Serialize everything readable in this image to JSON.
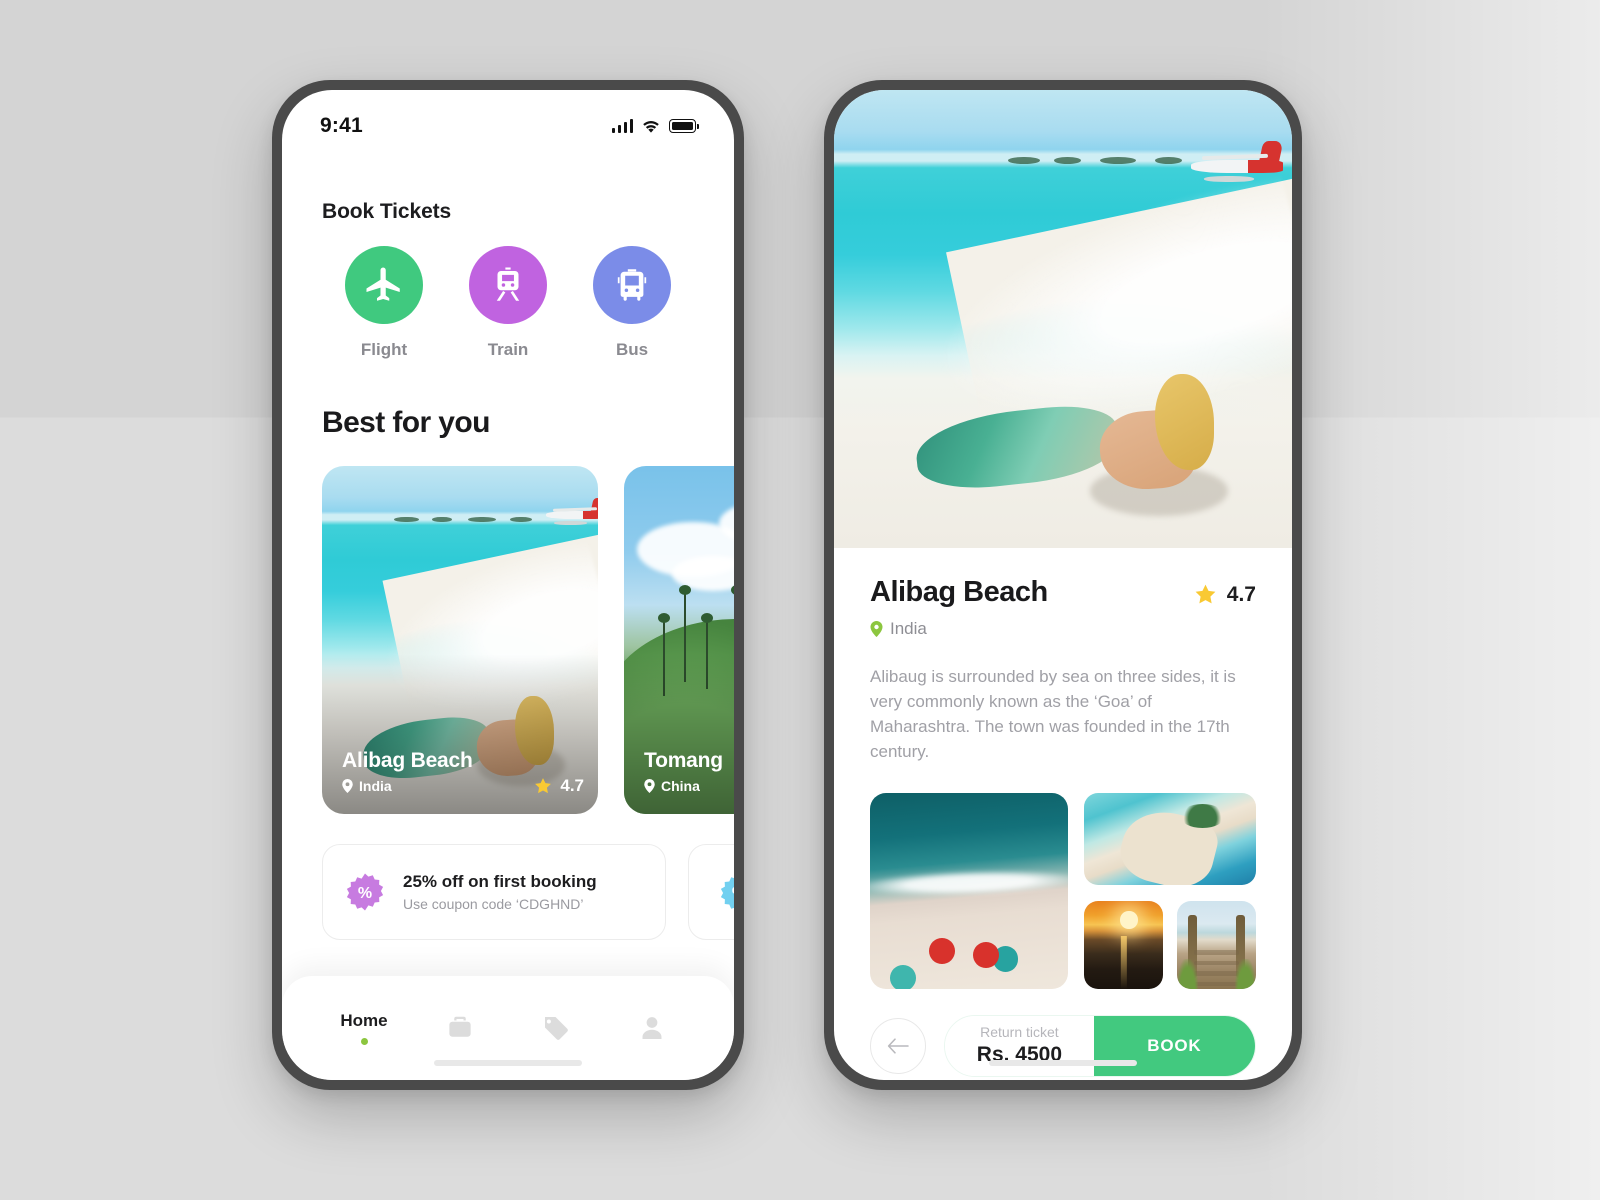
{
  "statusbar": {
    "time": "9:41"
  },
  "home": {
    "section_label": "Book Tickets",
    "categories": [
      {
        "label": "Flight",
        "icon": "plane-icon",
        "color": "#40C97F"
      },
      {
        "label": "Train",
        "icon": "train-icon",
        "color": "#C063E0"
      },
      {
        "label": "Bus",
        "icon": "bus-icon",
        "color": "#7B8CE8"
      }
    ],
    "best_title": "Best for you",
    "destinations": [
      {
        "name": "Alibag Beach",
        "country": "India",
        "rating": "4.7",
        "photo": "maldives-beach-seaplane-mermaid"
      },
      {
        "name": "Tomang",
        "country": "China",
        "rating": "",
        "photo": "green-mountain-palms"
      }
    ],
    "coupons": [
      {
        "title": "25% off on first booking",
        "subtitle": "Use coupon code ‘CDGHND’",
        "badge_color": "#C77BE0"
      },
      {
        "title": "",
        "subtitle": "",
        "badge_color": "#72D0F0"
      }
    ],
    "tabs": [
      {
        "label": "Home",
        "icon": "home-label",
        "active": true
      },
      {
        "label": "",
        "icon": "briefcase-icon",
        "active": false
      },
      {
        "label": "",
        "icon": "tag-icon",
        "active": false
      },
      {
        "label": "",
        "icon": "person-icon",
        "active": false
      }
    ]
  },
  "detail": {
    "hero_photo": "maldives-beach-seaplane-mermaid",
    "title": "Alibag Beach",
    "rating": "4.7",
    "country": "India",
    "description": "Alibaug is surrounded by sea on three sides, it is very commonly known as the ‘Goa’ of Maharashtra. The town was founded in the 17th century.",
    "gallery": [
      {
        "photo": "aerial-beach-umbrellas"
      },
      {
        "photo": "sandbar-island"
      },
      {
        "photo": "sunset-over-water"
      },
      {
        "photo": "wooden-boardwalk"
      }
    ],
    "price_caption": "Return ticket",
    "price_value": "Rs. 4500",
    "book_label": "BOOK",
    "back_icon": "arrow-left-icon",
    "accent_color": "#42C97F"
  }
}
